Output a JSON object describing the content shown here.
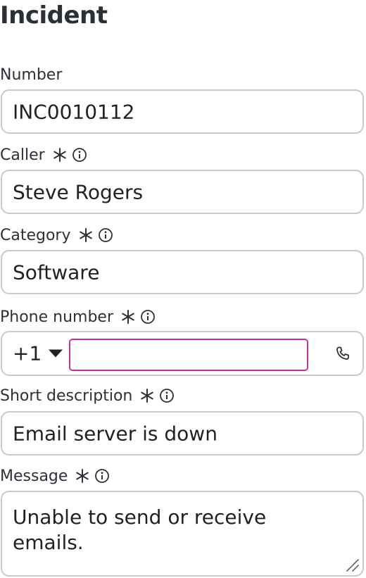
{
  "page": {
    "title": "Incident"
  },
  "fields": {
    "number": {
      "label": "Number",
      "value": "INC0010112"
    },
    "caller": {
      "label": "Caller",
      "value": "Steve Rogers",
      "required": true
    },
    "category": {
      "label": "Category",
      "value": "Software",
      "required": true
    },
    "phone": {
      "label": "Phone number",
      "country_code": "+1",
      "value": "",
      "required": true
    },
    "short_description": {
      "label": "Short description",
      "value": "Email server is down",
      "required": true
    },
    "message": {
      "label": "Message",
      "value": "Unable to send or receive emails.",
      "required": true
    }
  },
  "icons": {
    "required": "asterisk-icon",
    "info": "info-icon",
    "phone": "phone-icon",
    "resize": "resize-handle-icon",
    "dropdown": "caret-down-icon"
  },
  "colors": {
    "focus_border": "#c2319f",
    "field_border": "#c8c9cc",
    "text": "#1f2126"
  }
}
